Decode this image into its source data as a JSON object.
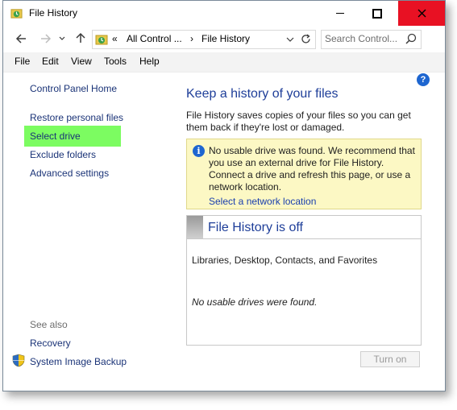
{
  "window": {
    "title": "File History",
    "close_color": "#e81123"
  },
  "nav": {
    "back_icon": "arrow-left-icon",
    "forward_icon": "arrow-right-icon",
    "up_icon": "arrow-up-icon",
    "breadcrumb_prefix": "«",
    "breadcrumb_parent": "All Control ...",
    "breadcrumb_sep": "›",
    "breadcrumb_current": "File History",
    "search_placeholder": "Search Control..."
  },
  "menu": {
    "items": [
      "File",
      "Edit",
      "View",
      "Tools",
      "Help"
    ]
  },
  "sidebar": {
    "home": "Control Panel Home",
    "links": [
      "Restore personal files",
      "Select drive",
      "Exclude folders",
      "Advanced settings"
    ],
    "selected_index": 1,
    "highlight_color": "#7cfc61",
    "see_also_label": "See also",
    "see_also": [
      "Recovery",
      "System Image Backup"
    ]
  },
  "main": {
    "heading": "Keep a history of your files",
    "description": "File History saves copies of your files so you can get them back if they're lost or damaged.",
    "warning": {
      "text": "No usable drive was found. We recommend that you use an external drive for File History. Connect a drive and refresh this page, or use a network location.",
      "link": "Select a network location"
    },
    "status": {
      "title": "File History is off",
      "libraries": "Libraries, Desktop, Contacts, and Favorites",
      "drives": "No usable drives were found."
    },
    "turn_on_label": "Turn on",
    "help_label": "?"
  },
  "colors": {
    "link": "#1a3377",
    "heading": "#1e3e99",
    "warning_bg": "#fcf8c4"
  }
}
